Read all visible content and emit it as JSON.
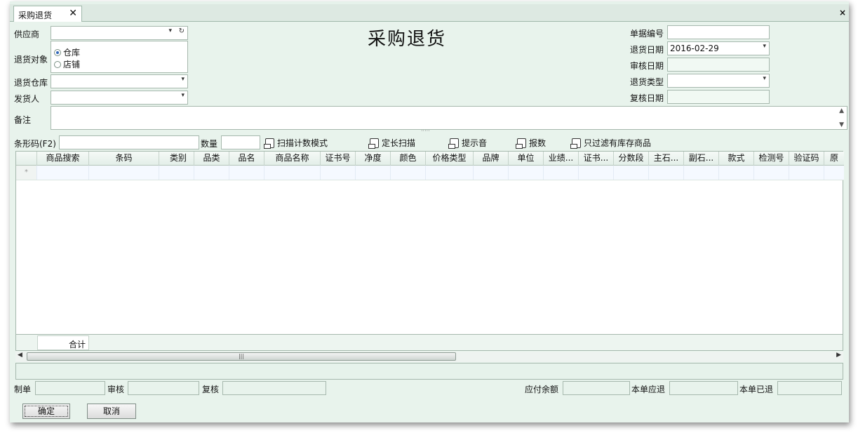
{
  "tab": {
    "label": "采购退货",
    "close": "✕"
  },
  "window": {
    "close": "×"
  },
  "form": {
    "title": "采购退货",
    "supplier_label": "供应商",
    "supplier_value": "",
    "return_target_label": "退货对象",
    "return_target_options": [
      "仓库",
      "店铺"
    ],
    "return_warehouse_label": "退货仓库",
    "return_warehouse_value": "",
    "shipper_label": "发货人",
    "shipper_value": "",
    "doc_no_label": "单据编号",
    "doc_no_value": "",
    "return_date_label": "退货日期",
    "return_date_value": "2016-02-29",
    "audit_date_label": "审核日期",
    "audit_date_value": "",
    "return_type_label": "退货类型",
    "return_type_value": "",
    "review_date_label": "复核日期",
    "review_date_value": "",
    "memo_label": "备注",
    "memo_value": ""
  },
  "scan": {
    "barcode_label": "条形码(F2)",
    "barcode_value": "",
    "qty_label": "数量",
    "qty_value": "",
    "options": [
      "扫描计数模式",
      "定长扫描",
      "提示音",
      "报数",
      "只过滤有库存商品"
    ]
  },
  "grid": {
    "columns": [
      "商品搜索",
      "条码",
      "类别",
      "品类",
      "品名",
      "商品名称",
      "证书号",
      "净度",
      "颜色",
      "价格类型",
      "品牌",
      "单位",
      "业绩...",
      "证书...",
      "分数段",
      "主石...",
      "副石...",
      "款式",
      "检测号",
      "验证码",
      "原"
    ],
    "new_row_marker": "*",
    "footer_label": "合计",
    "scroll_grip": "|||"
  },
  "bottom": {
    "maker_label": "制单",
    "maker_value": "",
    "auditor_label": "审核",
    "auditor_value": "",
    "reviewer_label": "复核",
    "reviewer_value": "",
    "payable_label": "应付余额",
    "payable_value": "",
    "should_return_label": "本单应退",
    "should_return_value": "",
    "returned_label": "本单已退",
    "returned_value": ""
  },
  "buttons": {
    "ok": "确定",
    "cancel": "取消"
  },
  "icons": {
    "dropdown": "chevron-down-icon",
    "refresh": "refresh-icon",
    "checkbox": "checkbox-icon"
  }
}
